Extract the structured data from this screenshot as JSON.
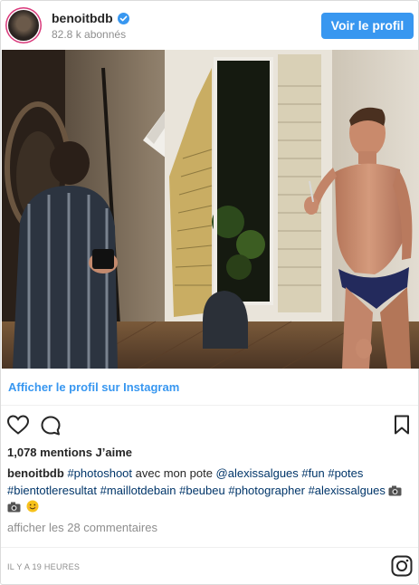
{
  "header": {
    "username": "benoitbdb",
    "followers": "82.8 k abonnés",
    "view_profile_button": "Voir le profil"
  },
  "post": {
    "instagram_link": "Afficher le profil sur Instagram",
    "likes": "1,078 mentions J’aime",
    "caption": {
      "user": "benoitbdb",
      "tag_photoshoot": "#photoshoot",
      "text_1": " avec mon pote ",
      "mention": "@alexissalgues",
      "tag_fun": "#fun",
      "tag_potes": "#potes",
      "tag_bientot": "#bientotleresultat",
      "tag_maillot": "#maillotdebain",
      "tag_beubeu": "#beubeu",
      "tag_photographer": "#photographer",
      "tag_alexis": "#alexissalgues"
    },
    "comments_link": "afficher les 28 commentaires",
    "timestamp": "IL Y A 19 HEURES"
  },
  "colors": {
    "accent": "#3897f0",
    "tag": "#003569",
    "muted": "#8e8e8e"
  },
  "icons": [
    "verified-badge-icon",
    "heart-icon",
    "comment-icon",
    "bookmark-icon",
    "instagram-logo-icon"
  ]
}
